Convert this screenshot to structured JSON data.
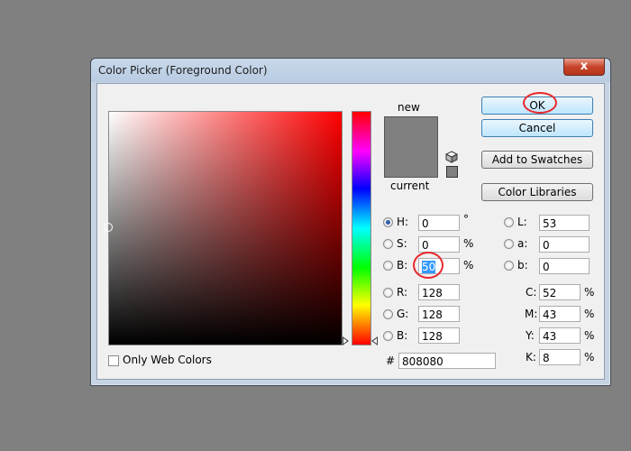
{
  "window": {
    "title": "Color Picker (Foreground Color)",
    "close_icon": "close-icon",
    "close_glyph": "x"
  },
  "preview": {
    "new_label": "new",
    "current_label": "current",
    "new_color": "#808080",
    "current_color": "#808080"
  },
  "buttons": {
    "ok": "OK",
    "cancel": "Cancel",
    "add_to_swatches": "Add to Swatches",
    "color_libraries": "Color Libraries"
  },
  "hsb": {
    "h": {
      "label": "H:",
      "value": "0",
      "unit": "°",
      "selected": true
    },
    "s": {
      "label": "S:",
      "value": "0",
      "unit": "%"
    },
    "b": {
      "label": "B:",
      "value": "50",
      "unit": "%"
    }
  },
  "rgb": {
    "r": {
      "label": "R:",
      "value": "128"
    },
    "g": {
      "label": "G:",
      "value": "128"
    },
    "b": {
      "label": "B:",
      "value": "128"
    }
  },
  "lab": {
    "l": {
      "label": "L:",
      "value": "53"
    },
    "a": {
      "label": "a:",
      "value": "0"
    },
    "b": {
      "label": "b:",
      "value": "0"
    }
  },
  "cmyk": {
    "c": {
      "label": "C:",
      "value": "52",
      "unit": "%"
    },
    "m": {
      "label": "M:",
      "value": "43",
      "unit": "%"
    },
    "y": {
      "label": "Y:",
      "value": "43",
      "unit": "%"
    },
    "k": {
      "label": "K:",
      "value": "8",
      "unit": "%"
    }
  },
  "hex": {
    "label": "#",
    "value": "808080"
  },
  "web_colors": {
    "label": "Only Web Colors",
    "checked": false
  },
  "colors": {
    "annotation_ring": "#e8272c",
    "selection": "#3399ff",
    "hue_base": "#ff0000"
  },
  "icons": {
    "gamut": "cube-icon",
    "web_safe": "web-safe-swatch-icon"
  }
}
